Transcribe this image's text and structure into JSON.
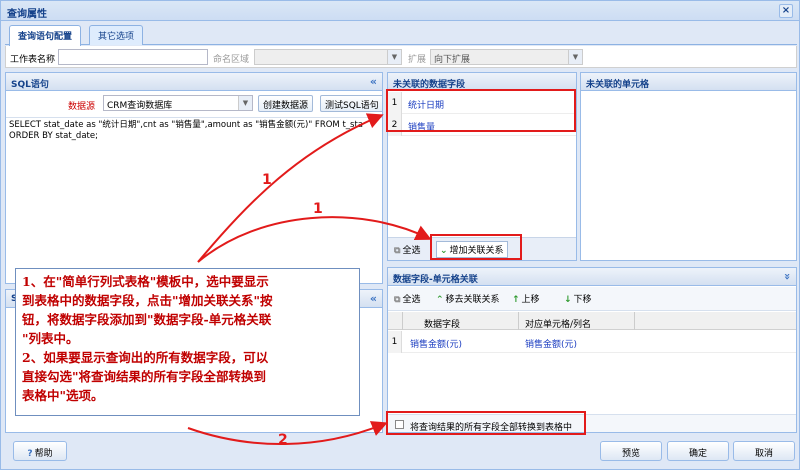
{
  "dialog": {
    "title": "查询属性",
    "close": "×"
  },
  "tabs": [
    {
      "label": "查询语句配置"
    },
    {
      "label": "其它选项"
    }
  ],
  "form": {
    "sheet_name_label": "工作表名称",
    "sheet_name_value": "",
    "region_label": "命名区域",
    "expand_label": "扩展",
    "expand_value": "向下扩展"
  },
  "sql_panel": {
    "title": "SQL语句",
    "collapse": "«",
    "datasource_label": "数据源",
    "datasource_value": "CRM查询数据库",
    "create_btn": "创建数据源",
    "test_btn": "测试SQL语句",
    "sql_line1": "SELECT stat_date as \"统计日期\",cnt as \"销售量\",amount as \"销售金额(元)\" FROM t_sta",
    "sql_line2": "ORDER BY stat_date;"
  },
  "sql_lower_panel": {
    "title": "SQ",
    "collapse": "«"
  },
  "unlinked_fields": {
    "title": "未关联的数据字段",
    "rows": [
      {
        "num": "1",
        "name": "统计日期"
      },
      {
        "num": "2",
        "name": "销售量"
      }
    ],
    "select_all": "全选",
    "add_link": "增加关联关系"
  },
  "unlinked_cells": {
    "title": "未关联的单元格"
  },
  "mapping": {
    "title": "数据字段-单元格关联",
    "collapse": "»",
    "toolbar": {
      "select_all": "全选",
      "remove": "移去关联关系",
      "up": "上移",
      "down": "下移"
    },
    "columns": [
      "数据字段",
      "对应单元格/列名"
    ],
    "rows": [
      {
        "num": "1",
        "field": "销售金额(元)",
        "cell": "销售金额(元)"
      }
    ],
    "convert_checkbox": "将查询结果的所有字段全部转换到表格中"
  },
  "callout": {
    "line1": "1、在\"简单行列式表格\"模板中，选中要显示",
    "line2": "到表格中的数据字段，点击\"增加关联关系\"按",
    "line3": "钮，将数据字段添加到\"数据字段-单元格关联",
    "line4": "\"列表中。",
    "line5": "2、如果要显示查询出的所有数据字段，可以",
    "line6": "直接勾选\"将查询结果的所有字段全部转换到",
    "line7": "表格中\"选项。"
  },
  "annotations": {
    "arrow1a": "1",
    "arrow1b": "1",
    "arrow2": "2"
  },
  "footer": {
    "help": "帮助",
    "preview": "预览",
    "ok": "确定",
    "cancel": "取消"
  }
}
